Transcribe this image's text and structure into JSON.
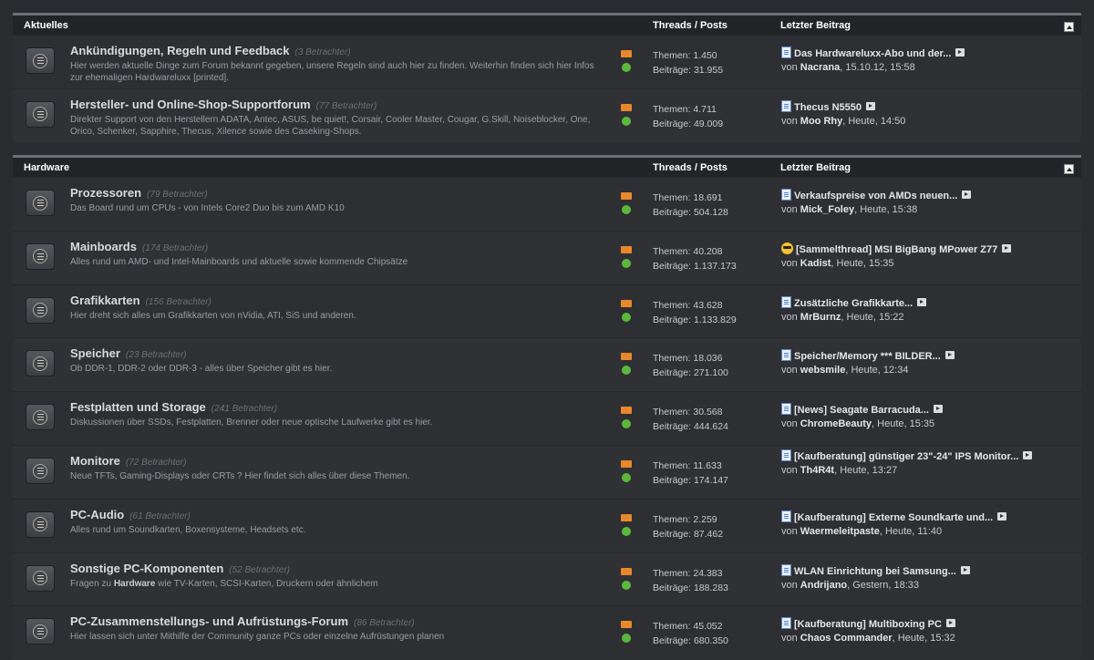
{
  "sections": [
    {
      "title": "Aktuelles",
      "col_threads": "Threads / Posts",
      "col_last": "Letzter Beitrag",
      "forums": [
        {
          "title": "Ankündigungen, Regeln und Feedback",
          "viewers": "(3 Betrachter)",
          "desc": "Hier werden aktuelle Dinge zum Forum bekannt gegeben, unsere Regeln sind auch hier zu finden. Weiterhin finden sich hier Infos zur ehemaligen Hardwareluxx [printed].",
          "themen": "Themen: 1.450",
          "beitraege": "Beiträge: 31.955",
          "last_title": "Das Hardwareluxx-Abo und der...",
          "last_user": "Nacrana",
          "last_time": ", 15.10.12, 15:58",
          "icon": "doc-icon"
        },
        {
          "title": "Hersteller- und Online-Shop-Supportforum",
          "viewers": "(77 Betrachter)",
          "desc": "Direkter Support von den Herstellern ADATA, Antec, ASUS, be quiet!, Corsair, Cooler Master, Cougar, G.Skill, Noiseblocker, One, Orico, Schenker, Sapphire, Thecus, Xilence sowie des Caseking-Shops.",
          "themen": "Themen: 4.711",
          "beitraege": "Beiträge: 49.009",
          "last_title": "Thecus N5550",
          "last_user": "Moo Rhy",
          "last_time": ", Heute, 14:50",
          "icon": "doc-icon"
        }
      ]
    },
    {
      "title": "Hardware",
      "col_threads": "Threads / Posts",
      "col_last": "Letzter Beitrag",
      "forums": [
        {
          "title": "Prozessoren",
          "viewers": "(79 Betrachter)",
          "desc": "Das Board rund um CPUs - von Intels Core2 Duo bis zum AMD K10",
          "themen": "Themen: 18.691",
          "beitraege": "Beiträge: 504.128",
          "last_title": "Verkaufspreise von AMDs neuen...",
          "last_user": "Mick_Foley",
          "last_time": ", Heute, 15:38",
          "icon": "doc-icon"
        },
        {
          "title": "Mainboards",
          "viewers": "(174 Betrachter)",
          "desc": "Alles rund um AMD- und Intel-Mainboards und aktuelle sowie kommende Chipsätze",
          "themen": "Themen: 40.208",
          "beitraege": "Beiträge: 1.137.173",
          "last_title": "[Sammelthread] MSI BigBang MPower Z77",
          "last_user": "Kadist",
          "last_time": ", Heute, 15:35",
          "icon": "smiley-icon"
        },
        {
          "title": "Grafikkarten",
          "viewers": "(156 Betrachter)",
          "desc": "Hier dreht sich alles um Grafikkarten von nVidia, ATI, SiS und anderen.",
          "themen": "Themen: 43.628",
          "beitraege": "Beiträge: 1.133.829",
          "last_title": "Zusätzliche Grafikkarte...",
          "last_user": "MrBurnz",
          "last_time": ", Heute, 15:22",
          "icon": "doc-icon"
        },
        {
          "title": "Speicher",
          "viewers": "(23 Betrachter)",
          "desc": "Ob DDR-1, DDR-2 oder DDR-3 - alles über Speicher gibt es hier.",
          "themen": "Themen: 18.036",
          "beitraege": "Beiträge: 271.100",
          "last_title": "Speicher/Memory *** BILDER...",
          "last_user": "websmile",
          "last_time": ", Heute, 12:34",
          "icon": "doc-icon"
        },
        {
          "title": "Festplatten und Storage",
          "viewers": "(241 Betrachter)",
          "desc": "Diskussionen über SSDs, Festplatten, Brenner oder neue optische Laufwerke gibt es hier.",
          "themen": "Themen: 30.568",
          "beitraege": "Beiträge: 444.624",
          "last_title": "[News] Seagate Barracuda...",
          "last_user": "ChromeBeauty",
          "last_time": ", Heute, 15:35",
          "icon": "doc-icon"
        },
        {
          "title": "Monitore",
          "viewers": "(72 Betrachter)",
          "desc": "Neue TFTs, Gaming-Displays oder CRTs ? Hier findet sich alles über diese Themen.",
          "themen": "Themen: 11.633",
          "beitraege": "Beiträge: 174.147",
          "last_title": "[Kaufberatung] günstiger 23\"-24\" IPS Monitor...",
          "last_user": "Th4R4t",
          "last_time": ", Heute, 13:27",
          "icon": "doc-icon"
        },
        {
          "title": "PC-Audio",
          "viewers": "(61 Betrachter)",
          "desc": "Alles rund um Soundkarten, Boxensysteme, Headsets etc.",
          "themen": "Themen: 2.259",
          "beitraege": "Beiträge: 87.462",
          "last_title": "[Kaufberatung] Externe Soundkarte und...",
          "last_user": "Waermeleitpaste",
          "last_time": ", Heute, 11:40",
          "icon": "doc-icon"
        },
        {
          "title": "Sonstige PC-Komponenten",
          "viewers": "(52 Betrachter)",
          "desc_pre": "Fragen zu ",
          "desc_bold": "Hardware",
          "desc_post": " wie TV-Karten, SCSI-Karten, Druckern oder ähnlichem",
          "themen": "Themen: 24.383",
          "beitraege": "Beiträge: 188.283",
          "last_title": "WLAN Einrichtung bei Samsung...",
          "last_user": "Andrijano",
          "last_time": ", Gestern, 18:33",
          "icon": "doc-icon"
        },
        {
          "title": "PC-Zusammenstellungs- und Aufrüstungs-Forum",
          "viewers": "(86 Betrachter)",
          "desc": "Hier lassen sich unter Mithilfe der Community ganze PCs oder einzelne Aufrüstungen planen",
          "themen": "Themen: 45.052",
          "beitraege": "Beiträge: 680.350",
          "last_title": "[Kaufberatung] Multiboxing PC",
          "last_user": "Chaos Commander",
          "last_time": ", Heute, 15:32",
          "icon": "doc-icon"
        }
      ]
    }
  ],
  "von": "von "
}
